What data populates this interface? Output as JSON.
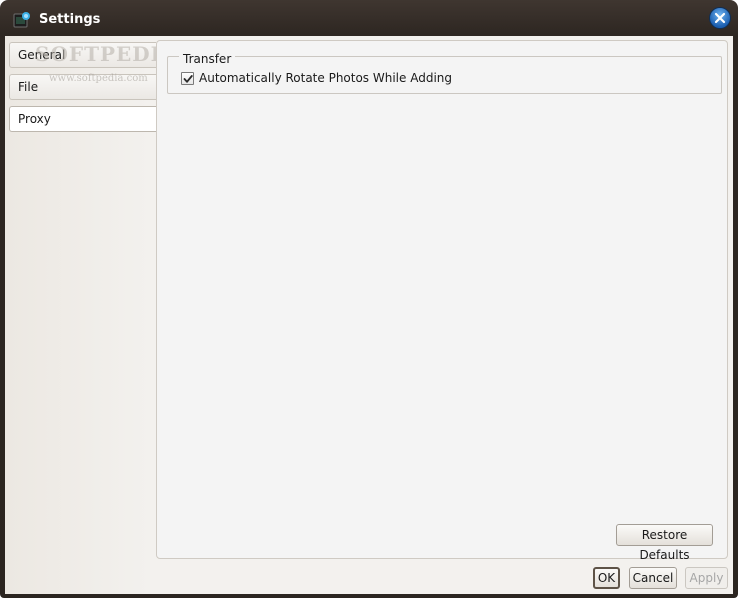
{
  "window": {
    "title": "Settings"
  },
  "icons": {
    "app": "app-icon",
    "close": "close-icon",
    "check": "check-icon"
  },
  "sidebar": {
    "items": [
      {
        "label": "General",
        "selected": false
      },
      {
        "label": "File",
        "selected": false
      },
      {
        "label": "Proxy",
        "selected": true
      }
    ]
  },
  "watermark": {
    "text": "SOFTPEDIA",
    "url": "www.softpedia.com"
  },
  "panel": {
    "group": {
      "title": "Transfer",
      "options": [
        {
          "label": "Automatically Rotate Photos While Adding",
          "checked": true
        }
      ]
    },
    "restore_label": "Restore Defaults"
  },
  "footer": {
    "ok_label": "OK",
    "cancel_label": "Cancel",
    "apply_label": "Apply",
    "apply_enabled": false
  },
  "colors": {
    "frame": "#2e2722",
    "accent_close": "#1c5fb0"
  }
}
